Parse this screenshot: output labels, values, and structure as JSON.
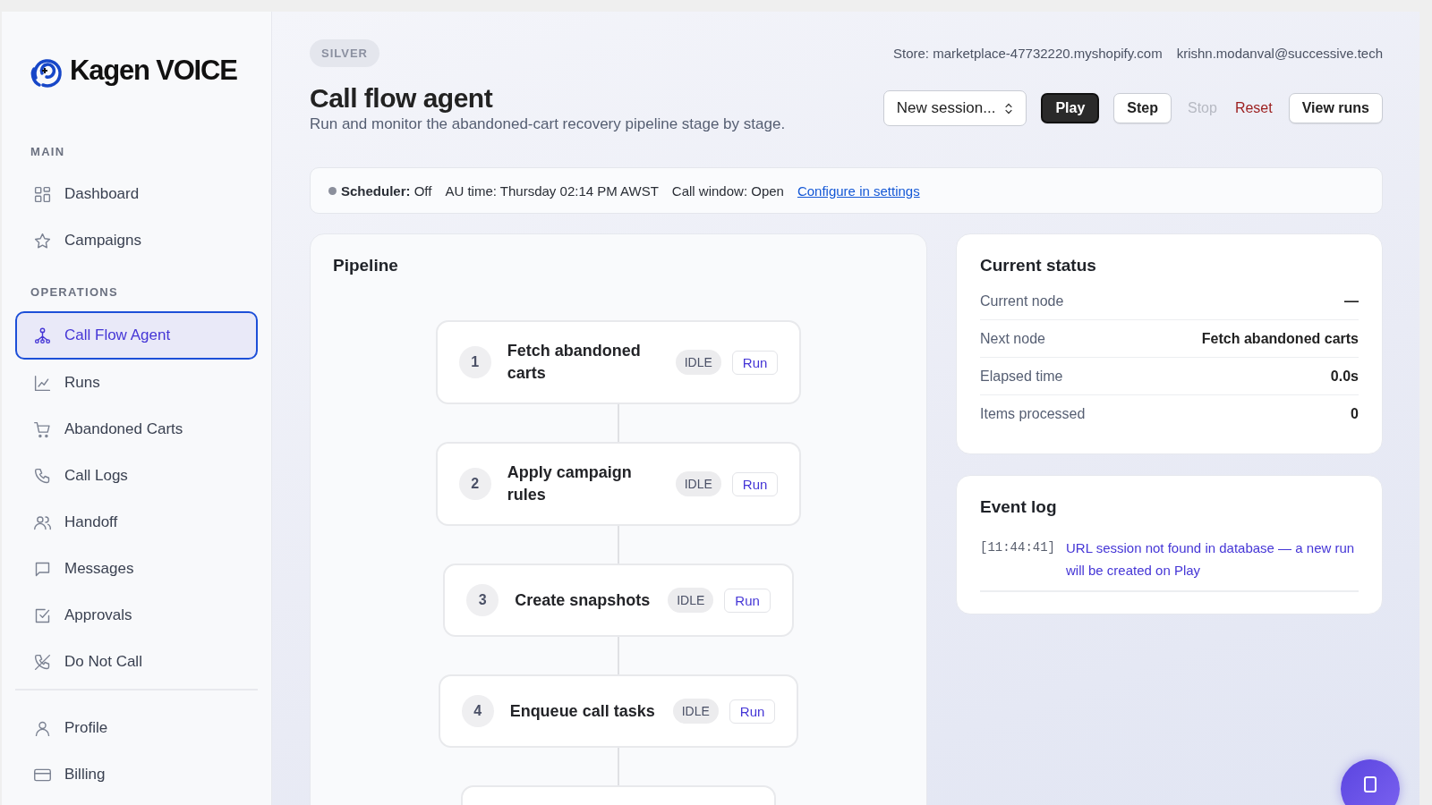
{
  "brand": {
    "name": "Kagen VOICE"
  },
  "sidebar": {
    "sections": [
      {
        "heading": "MAIN",
        "items": [
          {
            "label": "Dashboard",
            "selected": false
          },
          {
            "label": "Campaigns",
            "selected": false
          }
        ]
      },
      {
        "heading": "OPERATIONS",
        "items": [
          {
            "label": "Call Flow Agent",
            "selected": true
          },
          {
            "label": "Runs",
            "selected": false
          },
          {
            "label": "Abandoned Carts",
            "selected": false
          },
          {
            "label": "Call Logs",
            "selected": false
          },
          {
            "label": "Handoff",
            "selected": false
          },
          {
            "label": "Messages",
            "selected": false
          },
          {
            "label": "Approvals",
            "selected": false
          },
          {
            "label": "Do Not Call",
            "selected": false
          }
        ]
      },
      {
        "items": [
          {
            "label": "Profile",
            "selected": false
          },
          {
            "label": "Billing",
            "selected": false
          }
        ]
      }
    ]
  },
  "header": {
    "plan_badge": "SILVER",
    "store": "Store: marketplace-47732220.myshopify.com",
    "user_email": "krishn.modanval@successive.tech",
    "title": "Call flow agent",
    "subtitle": "Run and monitor the abandoned-cart recovery pipeline stage by stage.",
    "session_select": {
      "value": "New session..."
    },
    "buttons": [
      {
        "label": "Play",
        "kind": "primary",
        "disabled": false
      },
      {
        "label": "Step",
        "kind": "outline",
        "disabled": false
      },
      {
        "label": "Stop",
        "kind": "plain",
        "disabled": true
      },
      {
        "label": "Reset",
        "kind": "danger",
        "disabled": false
      },
      {
        "label": "View runs",
        "kind": "outline",
        "disabled": false
      }
    ]
  },
  "status_bar": {
    "scheduler_label": "Scheduler:",
    "scheduler_value": "Off",
    "scheduler_on": false,
    "au_time": "AU time: Thursday 02:14 PM AWST",
    "call_window": "Call window: Open",
    "link": "Configure in settings"
  },
  "pipeline": {
    "title": "Pipeline",
    "nodes": [
      {
        "number": "1",
        "label": "Fetch abandoned carts",
        "status": "IDLE",
        "action": "Run"
      },
      {
        "number": "2",
        "label": "Apply campaign rules",
        "status": "IDLE",
        "action": "Run"
      },
      {
        "number": "3",
        "label": "Create snapshots",
        "status": "IDLE",
        "action": "Run"
      },
      {
        "number": "4",
        "label": "Enqueue call tasks",
        "status": "IDLE",
        "action": "Run"
      }
    ]
  },
  "current_status": {
    "title": "Current status",
    "rows": [
      {
        "label": "Current node",
        "value": "—"
      },
      {
        "label": "Next node",
        "value": "Fetch abandoned carts"
      },
      {
        "label": "Elapsed time",
        "value": "0.0s"
      },
      {
        "label": "Items processed",
        "value": "0"
      }
    ]
  },
  "event_log": {
    "title": "Event log",
    "entries": [
      {
        "time": "[11:44:41]",
        "message": "URL session not found in database — a new run will be created on Play"
      }
    ]
  }
}
